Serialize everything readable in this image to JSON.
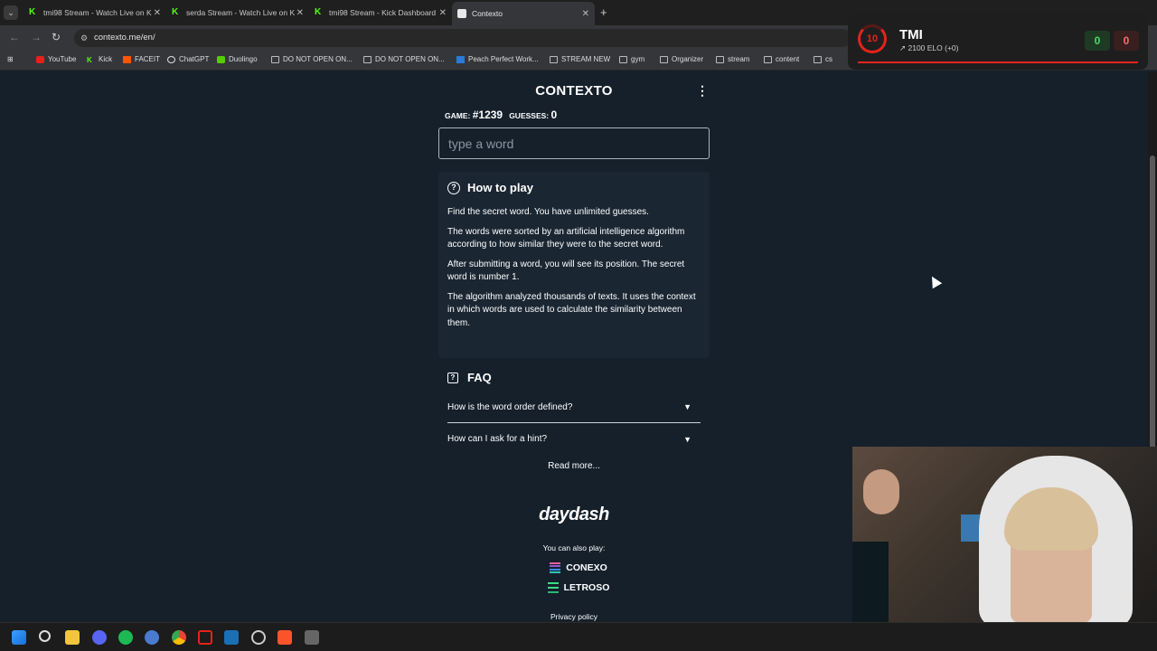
{
  "browser": {
    "tabs": [
      {
        "title": "tmi98 Stream - Watch Live on K",
        "favicon": "kick-icon"
      },
      {
        "title": "serda Stream - Watch Live on K",
        "favicon": "kick-icon"
      },
      {
        "title": "tmi98 Stream - Kick Dashboard",
        "favicon": "kick-icon"
      },
      {
        "title": "Contexto",
        "favicon": "contexto-icon",
        "active": true
      }
    ],
    "url": "contexto.me/en/",
    "bookmarks": [
      "YouTube",
      "Kick",
      "FACEIT",
      "ChatGPT",
      "Duolingo",
      "DO NOT OPEN ON...",
      "DO NOT OPEN ON...",
      "Peach Perfect Work...",
      "STREAM NEW",
      "gym",
      "Organizer",
      "stream",
      "content",
      "cs"
    ]
  },
  "game": {
    "title": "CONTEXTO",
    "game_label": "GAME:",
    "game_number": "#1239",
    "guesses_label": "GUESSES:",
    "guesses": "0",
    "input_placeholder": "type a word"
  },
  "howto": {
    "heading": "How to play",
    "paragraphs": [
      "Find the secret word. You have unlimited guesses.",
      "The words were sorted by an artificial intelligence algorithm according to how similar they were to the secret word.",
      "After submitting a word, you will see its position. The secret word is number 1.",
      "The algorithm analyzed thousands of texts. It uses the context in which words are used to calculate the similarity between them."
    ]
  },
  "faq": {
    "heading": "FAQ",
    "items": [
      "How is the word order defined?",
      "How can I ask for a hint?"
    ],
    "read_more": "Read more..."
  },
  "footer": {
    "brand": "daydash",
    "also_play": "You can also play:",
    "games": [
      "CONEXO",
      "LETROSO"
    ],
    "privacy": "Privacy policy"
  },
  "faceit": {
    "level": "10",
    "name": "TMI",
    "elo": "2100 ELO (+0)",
    "wins": "0",
    "losses": "0",
    "accent": "#e5231b"
  }
}
